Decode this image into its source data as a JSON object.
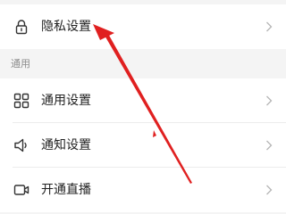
{
  "settings": {
    "privacy_item": {
      "label": "隐私设置",
      "icon": "lock-icon"
    },
    "general_section": {
      "header": "通用"
    },
    "items": [
      {
        "label": "通用设置",
        "icon": "grid-icon"
      },
      {
        "label": "通知设置",
        "icon": "speaker-icon"
      },
      {
        "label": "开通直播",
        "icon": "camera-icon"
      }
    ]
  },
  "annotation": {
    "arrow_color": "#e02020"
  }
}
